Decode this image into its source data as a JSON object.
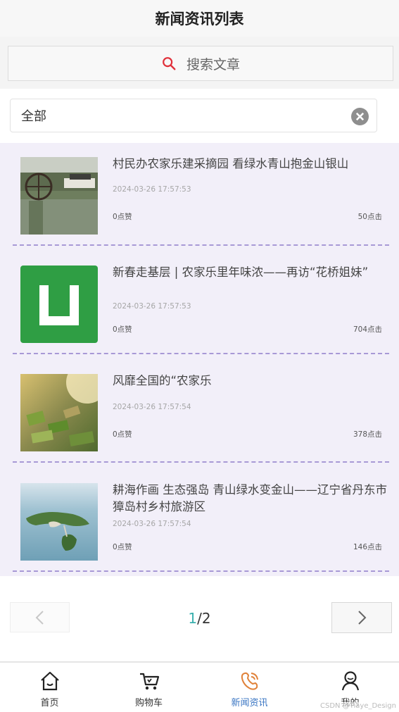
{
  "header": {
    "title": "新闻资讯列表"
  },
  "search": {
    "placeholder": "搜索文章"
  },
  "filter": {
    "value": "全部"
  },
  "articles": [
    {
      "title": "村民办农家乐建采摘园 看绿水青山抱金山银山",
      "date": "2024-03-26 17:57:53",
      "likes": "0点赞",
      "clicks": "50点击"
    },
    {
      "title": "新春走基层 | 农家乐里年味浓——再访“花桥姐妹”",
      "date": "2024-03-26 17:57:53",
      "likes": "0点赞",
      "clicks": "704点击"
    },
    {
      "title": "风靡全国的“农家乐",
      "date": "2024-03-26 17:57:54",
      "likes": "0点赞",
      "clicks": "378点击"
    },
    {
      "title": "耕海作画 生态强岛 青山绿水变金山——辽宁省丹东市獐岛村乡村旅游区",
      "date": "2024-03-26 17:57:54",
      "likes": "0点赞",
      "clicks": "146点击"
    }
  ],
  "pagination": {
    "current": "1",
    "total": "/2"
  },
  "tabs": [
    {
      "label": "首页",
      "icon": "home-icon"
    },
    {
      "label": "购物车",
      "icon": "cart-icon"
    },
    {
      "label": "新闻资讯",
      "icon": "news-icon",
      "active": true
    },
    {
      "label": "我的",
      "icon": "user-icon"
    }
  ],
  "watermark": "CSDN @Tiaye_Design",
  "colors": {
    "accent": "#3874c2",
    "pager_current": "#3ab0ae",
    "divider": "#a899d6",
    "list_bg": "#f2eff9"
  }
}
